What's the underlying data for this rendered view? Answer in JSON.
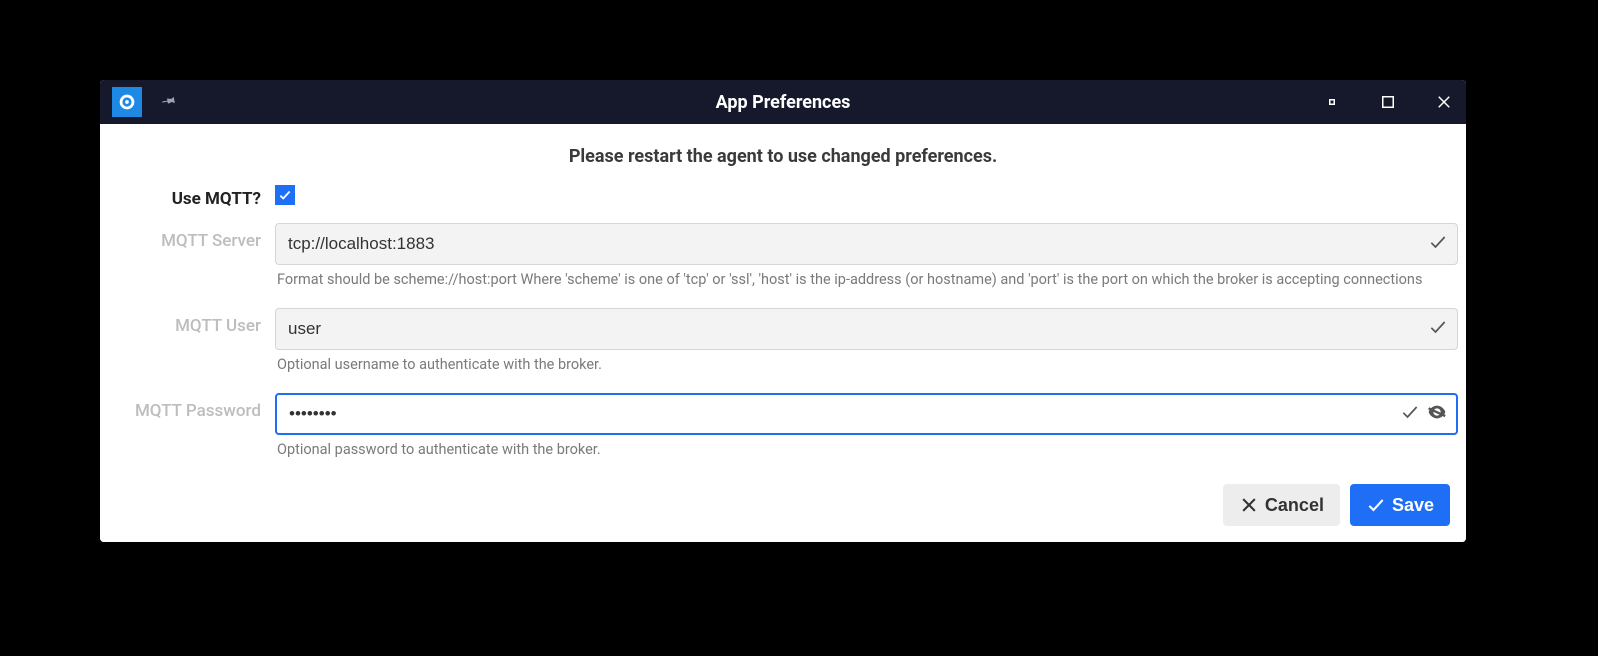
{
  "window": {
    "title": "App Preferences"
  },
  "notice": "Please restart the agent to use changed preferences.",
  "form": {
    "use_mqtt": {
      "label": "Use MQTT?",
      "checked": true
    },
    "server": {
      "label": "MQTT Server",
      "value": "tcp://localhost:1883",
      "help": "Format should be scheme://host:port Where 'scheme' is one of 'tcp' or 'ssl', 'host' is the ip-address (or hostname) and 'port' is the port on which the broker is accepting connections"
    },
    "user": {
      "label": "MQTT User",
      "value": "user",
      "help": "Optional username to authenticate with the broker."
    },
    "password": {
      "label": "MQTT Password",
      "value": "••••••••",
      "help": "Optional password to authenticate with the broker."
    }
  },
  "actions": {
    "cancel": "Cancel",
    "save": "Save"
  }
}
